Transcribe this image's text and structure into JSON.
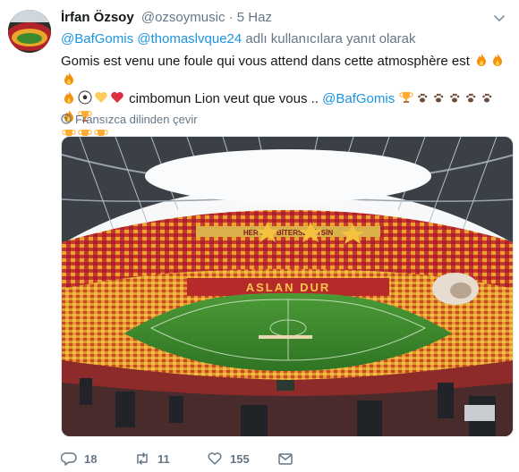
{
  "tweet": {
    "author_name": "İrfan Özsoy",
    "author_handle": "@ozsoymusic",
    "separator": "·",
    "time": "5 Haz",
    "reply_to_1": "@BafGomis",
    "reply_to_2": "@thomaslvque24",
    "reply_suffix": "adlı kullanıcılara yanıt olarak",
    "line1": "Gomis est venu une foule qui vous attend dans cette atmosphère est",
    "line2_text": "cimbomun Lion veut que vous ..",
    "line2_mention": "@BafGomis",
    "translate_label": "Fransızca dilinden çevir"
  },
  "actions": {
    "replies": "18",
    "retweets": "11",
    "likes": "155"
  },
  "photo": {
    "banner_text": "ASLAN DUR",
    "upper_banner": "HER ŞEY BİTERSE BİTSİN"
  },
  "colors": {
    "link": "#1b95e0",
    "muted": "#657786",
    "text": "#14171a",
    "stand_red": "#b2222a",
    "stand_yellow": "#e8a62b",
    "pitch": "#3d8a2e"
  }
}
